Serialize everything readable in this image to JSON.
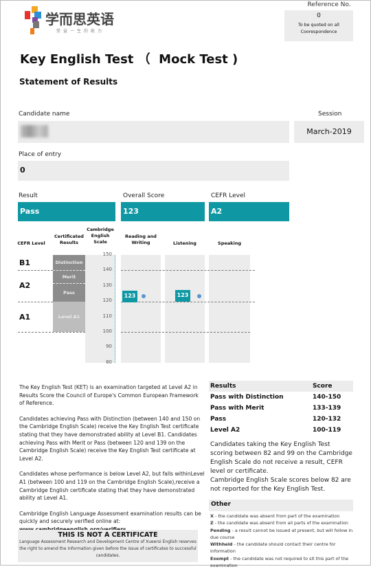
{
  "logo": {
    "name": "学而思英语",
    "tagline": "受益一生的能力",
    "colors": [
      "#e8332a",
      "#f5a623",
      "#2d8fd5",
      "#7d4a9c",
      "#f07d1a",
      "#777777"
    ]
  },
  "reference": {
    "label": "Reference No.",
    "value": "0",
    "note": "To be quoted on all Coorespondence"
  },
  "title": "Key English Test （  Mock Test )",
  "subtitle": "Statement of Results",
  "candidate": {
    "label": "Candidate name",
    "value": ""
  },
  "session": {
    "label": "Session",
    "value": "March-2019"
  },
  "place": {
    "label": "Place of entry",
    "value": "0"
  },
  "result": {
    "label": "Result",
    "value": "Pass"
  },
  "overall": {
    "label": "Overall Score",
    "value": "123"
  },
  "cefr": {
    "label": "CEFR Level",
    "value": "A2"
  },
  "accent": "#0f98a3",
  "chart": {
    "headers": {
      "cefr": "CEFR Level",
      "cert": "Certificated Results",
      "scale": "Cambridge English Scale",
      "rw": "Reading and Writing",
      "listening": "Listening",
      "speaking": "Speaking"
    },
    "levels": [
      "B1",
      "A2",
      "A1"
    ],
    "cert_bands": [
      "Distinction",
      "Merit",
      "Pass",
      "Level A1"
    ],
    "ticks": [
      "150",
      "140",
      "130",
      "120",
      "110",
      "100",
      "90",
      "80"
    ],
    "scores": {
      "rw": "123",
      "listening": "123"
    }
  },
  "chart_data": {
    "type": "bar",
    "scale_range": [
      80,
      150
    ],
    "categories": [
      "Reading and Writing",
      "Listening",
      "Speaking"
    ],
    "values": [
      123,
      123,
      null
    ]
  },
  "paragraphs": [
    "The Key English Test (KET) is an examination targeted at Level A2 in Results Score the Council of Europe's Common European Framework of Reference.",
    "Candidates achieving Pass with Distinction (between 140 and 150 on the Cambridge English Scale) receive the Key English Test certificate stating that they have demonstrated ability at Level B1. Candidates achieving Pass with Merit or Pass (between 120 and 139 on the Cambridge English Scale) receive the Key English Test certificate at Level A2.",
    "Candidates whose performance is below Level A2, but falls withinLevel A1 (between 100 and 119 on the Cambridge English Scale),receive a Cambridge English certificate stating that they have demonstrated ability at Level A1.",
    "Cambridge English Language Assessment examination results can be quickly and securely verified online at:"
  ],
  "verify_url": "www.cambridgeenglish.org/verifiers",
  "notice": {
    "title": "THIS IS NOT A CERTIFICATE",
    "text": "Language Assessment Research and Development Centre of Xueersi English reserves the right to amend the information given before the issue of certificates to successful candidates."
  },
  "results_table": {
    "headers": [
      "Results",
      "Score"
    ],
    "rows": [
      [
        "Pass with Distinction",
        "140-150"
      ],
      [
        "Pass with Merit",
        "133-139"
      ],
      [
        "Pass",
        "120-132"
      ],
      [
        "Level A2",
        "100-119"
      ]
    ]
  },
  "notes": [
    "Candidates taking the Key English Test scoring between 82 and 99 on the Cambridge English Scale do not receive a result, CEFR level or certificate.",
    "Cambridge English Scale scores below 82 are not reported for the Key English Test."
  ],
  "other": {
    "title": "Other",
    "items": [
      [
        "X",
        "- the candidate was absent from part of the examination"
      ],
      [
        "Z",
        "- the candidate was absent from all parts of the examination"
      ],
      [
        "Pending",
        "- a result cannot be issued at present, but will follow in due course"
      ],
      [
        "Withheld",
        "- the candidate should contact their centre for information"
      ],
      [
        "Exempt",
        "- the candidate was not required to sit this part of the examination"
      ]
    ]
  }
}
